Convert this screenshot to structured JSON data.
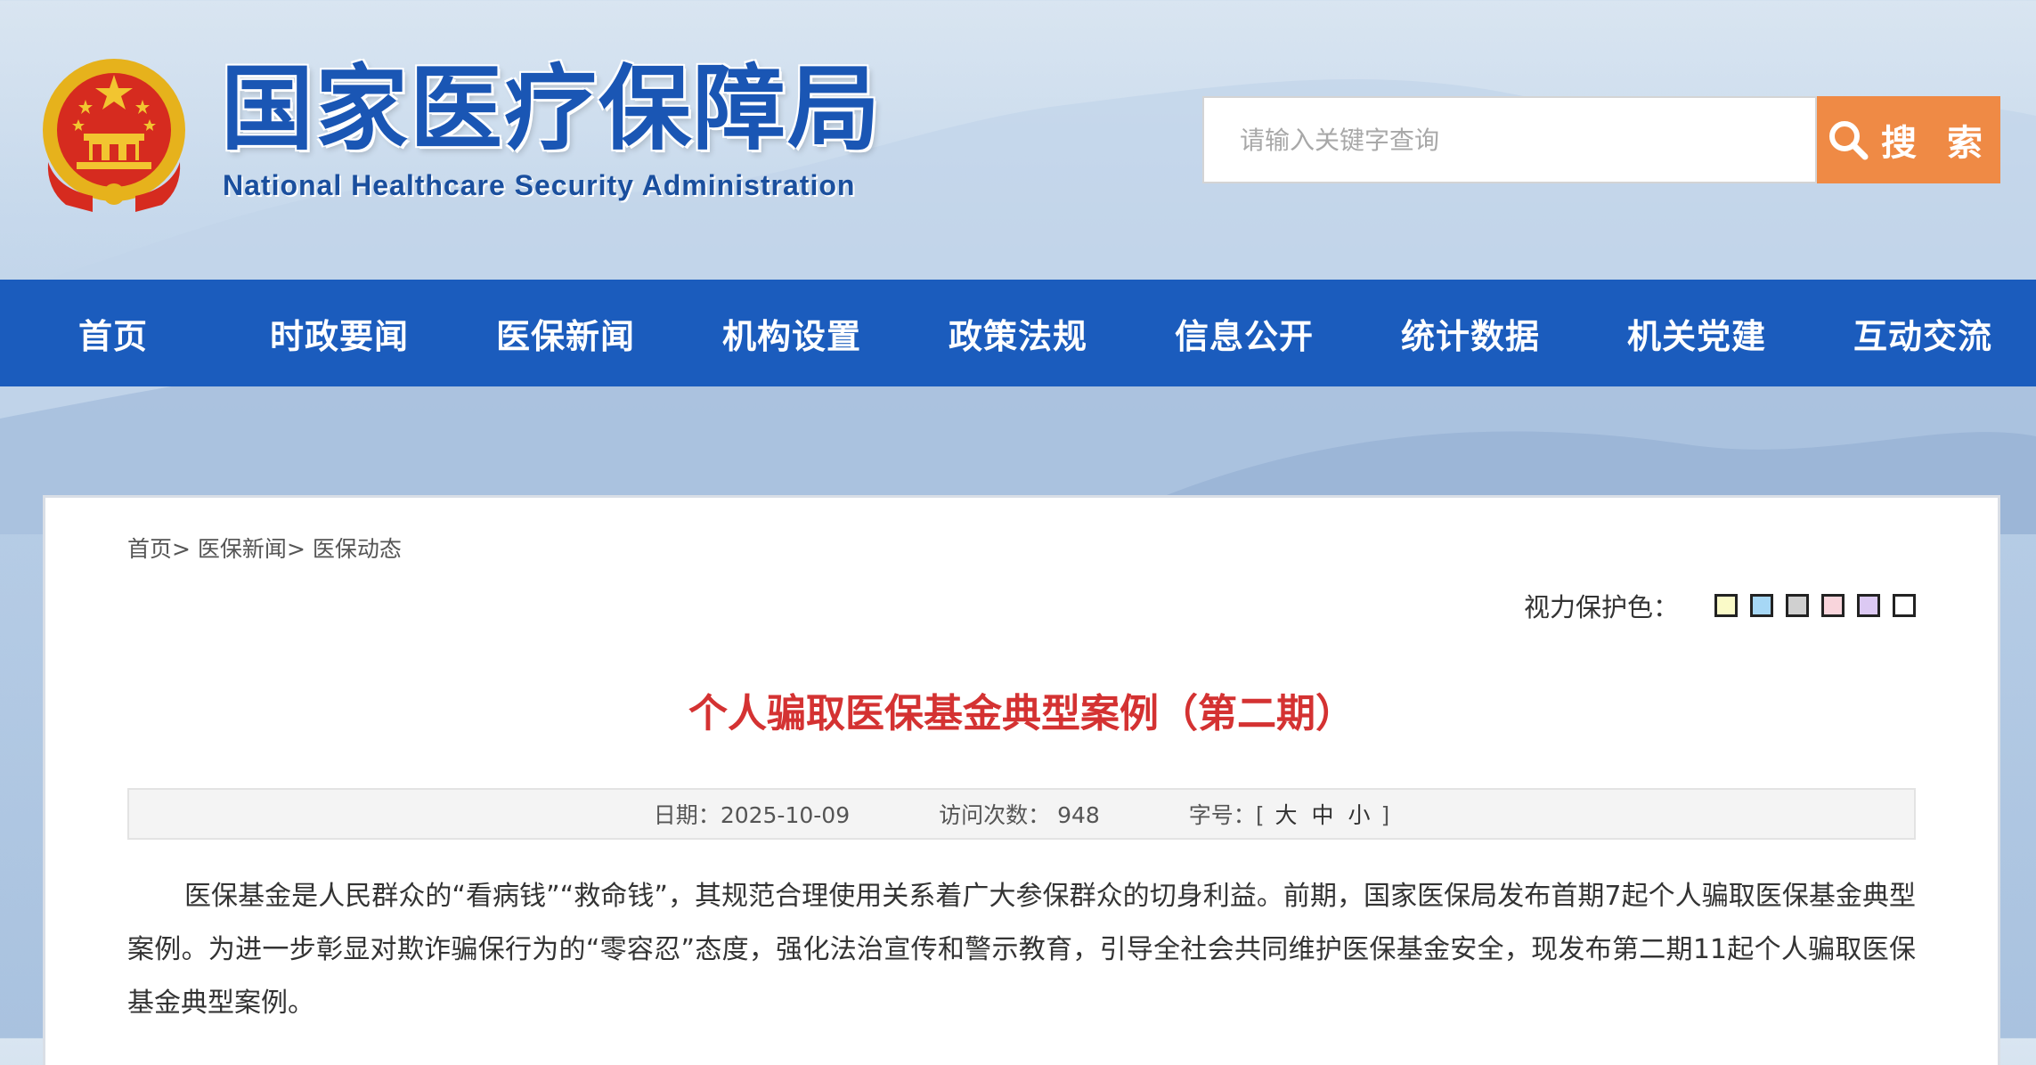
{
  "header": {
    "title": "国家医疗保障局",
    "subtitle": "National Healthcare Security Administration",
    "search_placeholder": "请输入关键字查询",
    "search_button": "搜 索"
  },
  "nav": {
    "items": [
      "首页",
      "时政要闻",
      "医保新闻",
      "机构设置",
      "政策法规",
      "信息公开",
      "统计数据",
      "机关党建",
      "互动交流"
    ]
  },
  "breadcrumb": {
    "items": [
      "首页",
      "医保新闻",
      "医保动态"
    ],
    "separator": ">"
  },
  "eye_care": {
    "label": "视力保护色：",
    "colors": [
      "#fafac8",
      "#a6d7f5",
      "#d0d0d0",
      "#f9d5dc",
      "#dcc9f3",
      "#ffffff"
    ]
  },
  "article": {
    "title": "个人骗取医保基金典型案例（第二期）",
    "date_label": "日期：",
    "date": "2025-10-09",
    "visits_label": "访问次数：",
    "visits": "948",
    "font_label": "字号：",
    "font_open": "[",
    "font_large": "大",
    "font_medium": "中",
    "font_small": "小",
    "font_close": "]",
    "body": "医保基金是人民群众的“看病钱”“救命钱”，其规范合理使用关系着广大参保群众的切身利益。前期，国家医保局发布首期7起个人骗取医保基金典型案例。为进一步彰显对欺诈骗保行为的“零容忍”态度，强化法治宣传和警示教育，引导全社会共同维护医保基金安全，现发布第二期11起个人骗取医保基金典型案例。"
  }
}
